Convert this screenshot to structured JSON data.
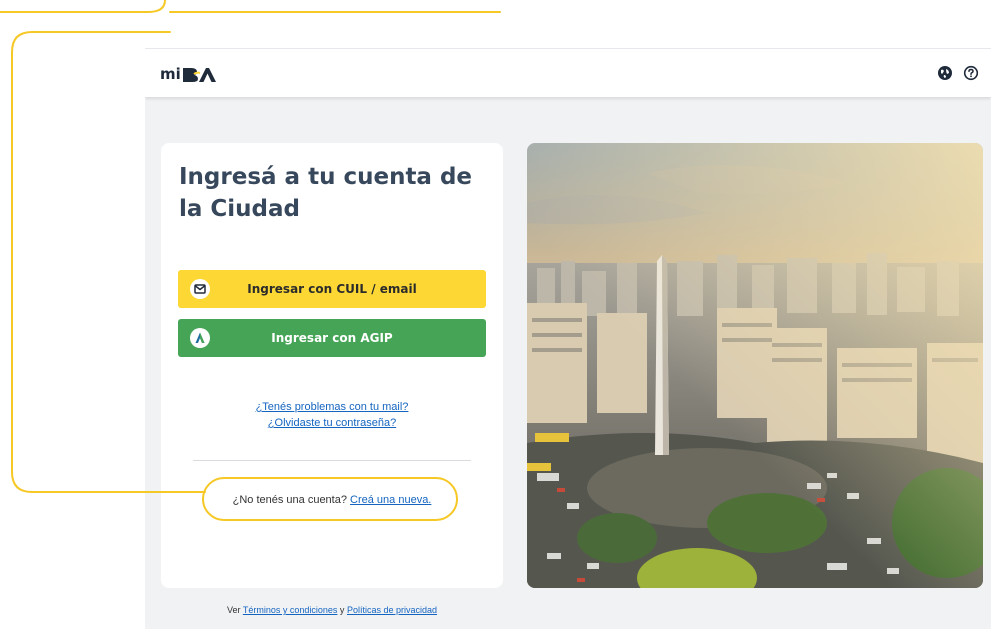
{
  "header": {
    "logo_text": "miBA",
    "icons": [
      "globe-icon",
      "help-icon"
    ]
  },
  "login": {
    "title": "Ingresá a tu cuenta de la Ciudad",
    "cuil_button": {
      "label": "Ingresar con CUIL / email",
      "icon": "mail-icon",
      "color": "#fdd835"
    },
    "agip_button": {
      "label": "Ingresar con AGIP",
      "icon": "agip-logo-icon",
      "color": "#45a455"
    },
    "links": {
      "mail_problem": "¿Tenés problemas con tu mail?",
      "forgot_password": "¿Olvidaste tu contraseña?"
    },
    "signup": {
      "prompt": "¿No tenés una cuenta?",
      "link": "Creá una nueva."
    }
  },
  "footer": {
    "prefix": "Ver",
    "terms_link": "Términos y condiciones",
    "conjunction": "y",
    "privacy_link": "Políticas de privacidad"
  },
  "colors": {
    "annotation": "#f6c825",
    "link": "#1565c0",
    "title": "#38485c"
  }
}
